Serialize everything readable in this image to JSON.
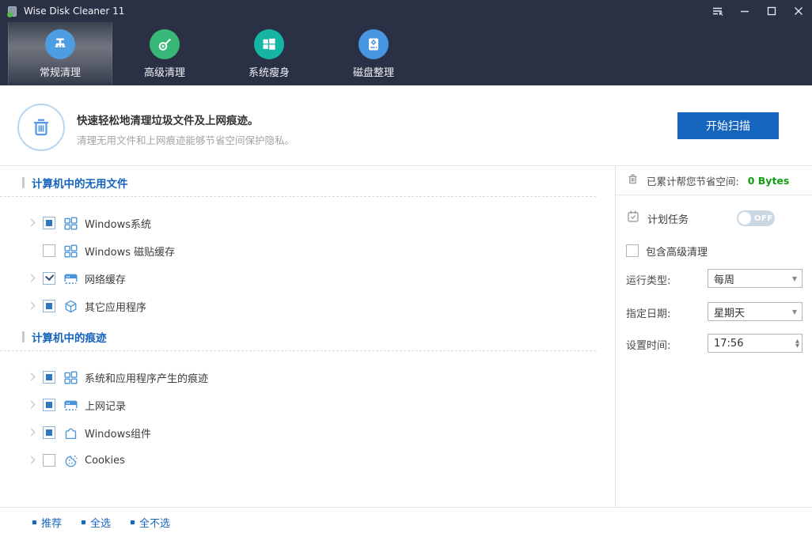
{
  "window": {
    "title": "Wise Disk Cleaner 11"
  },
  "nav": {
    "tabs": [
      {
        "label": "常规清理",
        "icon": "broom-icon",
        "color": "#4e9de0",
        "active": true
      },
      {
        "label": "高级清理",
        "icon": "snail-cleaner-icon",
        "color": "#36b877",
        "active": false
      },
      {
        "label": "系统瘦身",
        "icon": "windows-logo-icon",
        "color": "#14b5a2",
        "active": false
      },
      {
        "label": "磁盘整理",
        "icon": "hard-disk-icon",
        "color": "#4796e2",
        "active": false
      }
    ]
  },
  "header": {
    "title": "快速轻松地清理垃圾文件及上网痕迹。",
    "subtitle": "清理无用文件和上网痕迹能够节省空间保护隐私。",
    "scan_button": "开始扫描"
  },
  "tree": {
    "sections": [
      {
        "title": "计算机中的无用文件",
        "items": [
          {
            "label": "Windows系统",
            "state": "partial",
            "expandable": true,
            "icon": "windows-tiles-icon"
          },
          {
            "label": "Windows 磁贴缓存",
            "state": "unchecked",
            "expandable": false,
            "icon": "windows-tiles-icon"
          },
          {
            "label": "网络缓存",
            "state": "checked",
            "expandable": true,
            "icon": "browser-cache-icon"
          },
          {
            "label": "其它应用程序",
            "state": "partial",
            "expandable": true,
            "icon": "cube-icon"
          }
        ]
      },
      {
        "title": "计算机中的痕迹",
        "items": [
          {
            "label": "系统和应用程序产生的痕迹",
            "state": "partial",
            "expandable": true,
            "icon": "windows-tiles-icon"
          },
          {
            "label": "上网记录",
            "state": "partial",
            "expandable": true,
            "icon": "browser-cache-icon"
          },
          {
            "label": "Windows组件",
            "state": "partial",
            "expandable": true,
            "icon": "puzzle-icon"
          },
          {
            "label": "Cookies",
            "state": "unchecked",
            "expandable": true,
            "icon": "cookie-icon"
          }
        ]
      }
    ]
  },
  "panel": {
    "saved_label": "已累计帮您节省空间:",
    "saved_value": "0 Bytes",
    "schedule_label": "计划任务",
    "schedule_toggle": "OFF",
    "include_advanced_label": "包含高级清理",
    "include_advanced_state": "unchecked",
    "run_type_label": "运行类型:",
    "run_type_value": "每周",
    "date_label": "指定日期:",
    "date_value": "星期天",
    "time_label": "设置时间:",
    "time_value": "17:56"
  },
  "footer": {
    "links": [
      {
        "label": "推荐"
      },
      {
        "label": "全选"
      },
      {
        "label": "全不选"
      }
    ]
  },
  "colors": {
    "titlebar_bg": "#2b3145",
    "accent_blue": "#1565bf",
    "section_title_blue": "#1464bd",
    "link_blue": "#1766c0",
    "saved_green": "#109e10",
    "tree_icon_blue": "#4a93d8"
  }
}
